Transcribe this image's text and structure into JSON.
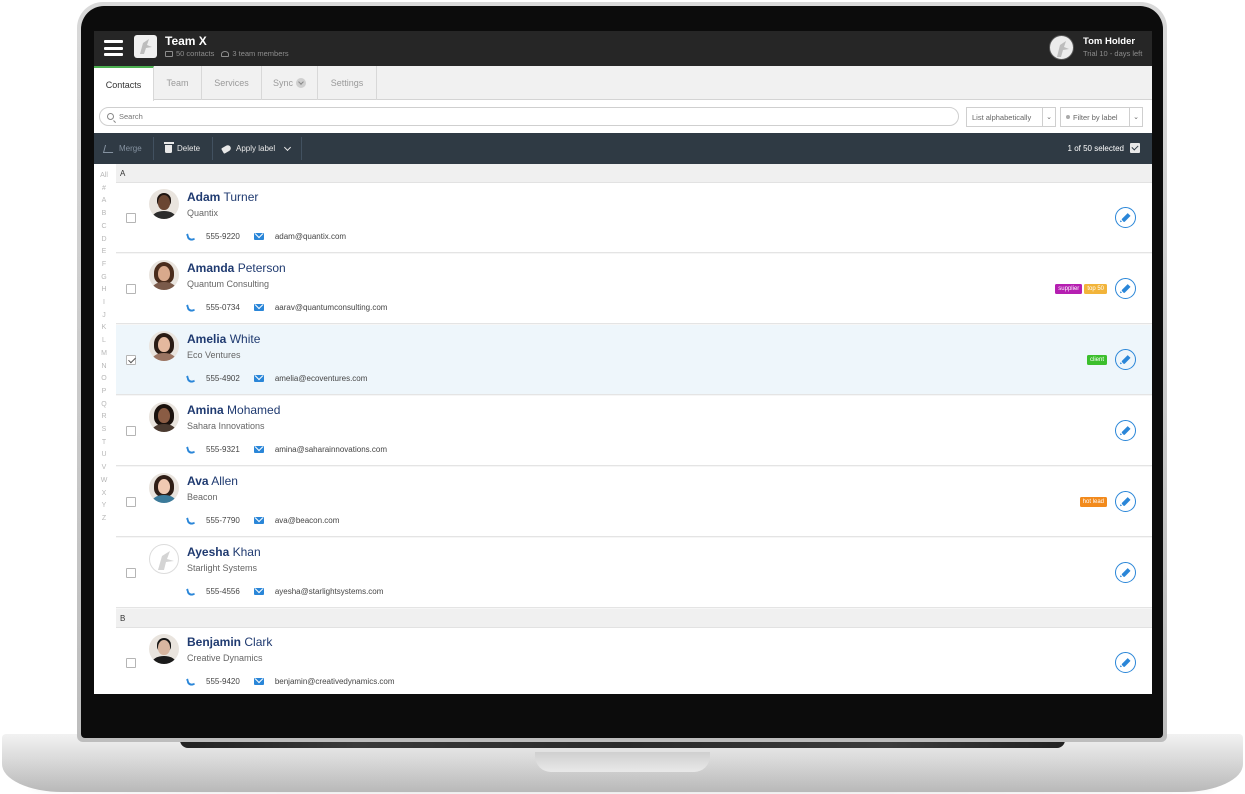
{
  "header": {
    "team_name": "Team X",
    "contacts_count": "50 contacts",
    "members_count": "3 team members",
    "user_name": "Tom Holder",
    "user_trial": "Trial 10 - days left"
  },
  "tabs": [
    {
      "label": "Contacts",
      "active": true
    },
    {
      "label": "Team",
      "active": false
    },
    {
      "label": "Services",
      "active": false
    },
    {
      "label": "Sync",
      "active": false
    },
    {
      "label": "Settings",
      "active": false
    }
  ],
  "search": {
    "placeholder": "Search",
    "sort_value": "List alphabetically",
    "filter_value": "Filter by label"
  },
  "actions": {
    "merge": "Merge",
    "delete": "Delete",
    "apply_label": "Apply label",
    "selected": "1 of 50 selected"
  },
  "alpha_index": [
    "All",
    "#",
    "A",
    "B",
    "C",
    "D",
    "E",
    "F",
    "G",
    "H",
    "I",
    "J",
    "K",
    "L",
    "M",
    "N",
    "O",
    "P",
    "Q",
    "R",
    "S",
    "T",
    "U",
    "V",
    "W",
    "X",
    "Y",
    "Z"
  ],
  "sections": [
    {
      "letter": "A",
      "contacts": [
        {
          "first": "Adam",
          "last": "Turner",
          "company": "Quantix",
          "phone": "555-9220",
          "email": "adam@quantix.com",
          "selected": false,
          "labels": []
        },
        {
          "first": "Amanda",
          "last": "Peterson",
          "company": "Quantum Consulting",
          "phone": "555-0734",
          "email": "aarav@quantumconsulting.com",
          "selected": false,
          "labels": [
            {
              "text": "supplier",
              "color": "#b51fb1"
            },
            {
              "text": "top 50",
              "color": "#f2b43a"
            }
          ]
        },
        {
          "first": "Amelia",
          "last": "White",
          "company": "Eco Ventures",
          "phone": "555-4902",
          "email": "amelia@ecoventures.com",
          "selected": true,
          "labels": [
            {
              "text": "client",
              "color": "#3cbf2c"
            }
          ]
        },
        {
          "first": "Amina",
          "last": "Mohamed",
          "company": "Sahara Innovations",
          "phone": "555-9321",
          "email": "amina@saharainnovations.com",
          "selected": false,
          "labels": []
        },
        {
          "first": "Ava",
          "last": "Allen",
          "company": "Beacon",
          "phone": "555-7790",
          "email": "ava@beacon.com",
          "selected": false,
          "labels": [
            {
              "text": "hot lead",
              "color": "#f28a1c"
            }
          ]
        },
        {
          "first": "Ayesha",
          "last": "Khan",
          "company": "Starlight Systems",
          "phone": "555-4556",
          "email": "ayesha@starlightsystems.com",
          "selected": false,
          "labels": []
        }
      ]
    },
    {
      "letter": "B",
      "contacts": [
        {
          "first": "Benjamin",
          "last": "Clark",
          "company": "Creative Dynamics",
          "phone": "555-9420",
          "email": "benjamin@creativedynamics.com",
          "selected": false,
          "labels": []
        }
      ]
    }
  ],
  "colors": {
    "accent": "#2a86d8",
    "topbar": "#262626",
    "actionbar": "#2f3a44",
    "name": "#1f3a70",
    "tab_active": "#4caf50"
  }
}
